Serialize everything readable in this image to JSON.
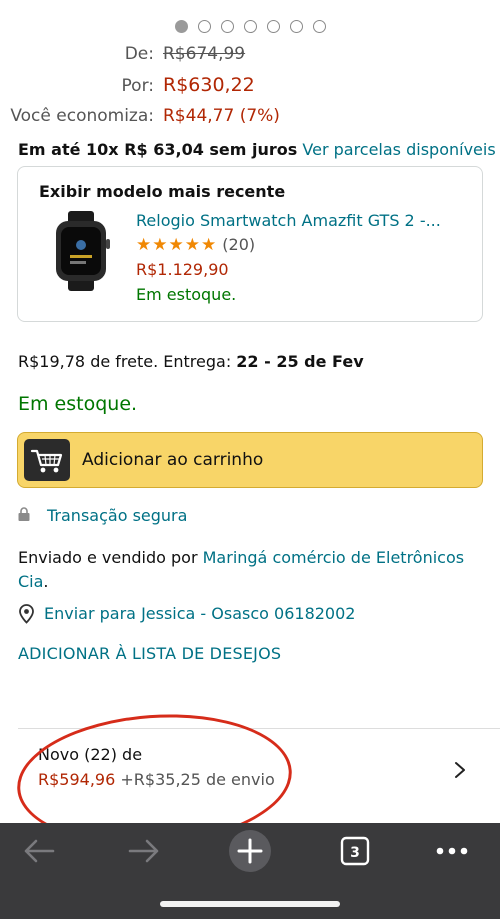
{
  "carousel": {
    "total": 7,
    "active": 0
  },
  "pricing": {
    "de_label": "De:",
    "de_value": "R$674,99",
    "por_label": "Por:",
    "por_value": "R$630,22",
    "economiza_label": "Você economiza:",
    "economiza_value": "R$44,77 (7%)"
  },
  "installments": {
    "text": "Em até 10x R$ 63,04 sem juros",
    "link": "Ver parcelas disponíveis"
  },
  "newer_model": {
    "title": "Exibir modelo mais recente",
    "product_name": "Relogio Smartwatch Amazfit GTS 2 -...",
    "stars": "★★★★★",
    "rating_count": "(20)",
    "price": "R$1.129,90",
    "stock": "Em estoque."
  },
  "shipping": {
    "prefix": "R$19,78 de frete. Entrega: ",
    "dates": "22 - 25 de Fev"
  },
  "stock_status": "Em estoque.",
  "cart_button": {
    "label": "Adicionar ao carrinho",
    "icon": "cart-icon"
  },
  "secure": {
    "label": "Transação segura",
    "icon": "lock-icon"
  },
  "sold_by": {
    "prefix": "Enviado e vendido por ",
    "seller": "Maringá comércio de Eletrônicos Cia",
    "suffix": "."
  },
  "ship_to": {
    "label": "Enviar para Jessica - Osasco 06182002",
    "icon": "location-pin-icon"
  },
  "wishlist": "ADICIONAR À LISTA DE DESEJOS",
  "offers": {
    "title": "Novo (22) de",
    "price": "R$594,96",
    "shipping": "+R$35,25 de envio"
  },
  "toolbar": {
    "icons": [
      "back-arrow-icon",
      "forward-arrow-icon",
      "new-tab-plus-icon",
      "tabs-count-icon",
      "more-dots-icon"
    ],
    "tab_count": "3"
  },
  "colors": {
    "price_red": "#b12704",
    "link_teal": "#007185",
    "stock_green": "#007600",
    "cart_yellow": "#f8d568",
    "annotation_red": "#d62c1a",
    "toolbar_bg": "#3a3a3c"
  }
}
